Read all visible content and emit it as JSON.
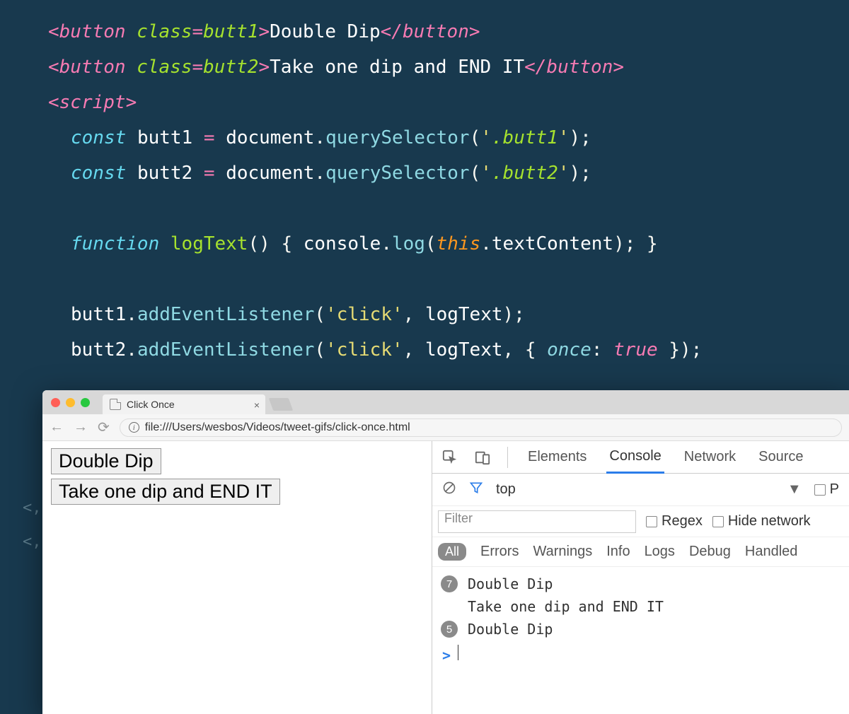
{
  "code": {
    "line1": {
      "tag_open": "<button",
      "attr": " class",
      "eq": "=",
      "val": "butt1",
      "gt": ">",
      "text": "Double Dip",
      "close": "</button>"
    },
    "line2": {
      "tag_open": "<button",
      "attr": " class",
      "eq": "=",
      "val": "butt2",
      "gt": ">",
      "text": "Take one dip and END IT",
      "close": "</button>"
    },
    "line3": {
      "open": "<script",
      "gt": ">"
    },
    "line4": {
      "kw": "const",
      "sp": " ",
      "id": "butt1",
      "eq": " = ",
      "doc": "document",
      "dot": ".",
      "fn": "querySelector",
      "lp": "(",
      "s1": "'",
      "sel": ".butt1",
      "s2": "'",
      "rp": ");"
    },
    "line5": {
      "kw": "const",
      "sp": " ",
      "id": "butt2",
      "eq": " = ",
      "doc": "document",
      "dot": ".",
      "fn": "querySelector",
      "lp": "(",
      "s1": "'",
      "sel": ".butt2",
      "s2": "'",
      "rp": ");"
    },
    "line6": {
      "kw": "function",
      "name": " logText",
      "args": "() ",
      "lb": "{ ",
      "obj": "console",
      "dot": ".",
      "fn": "log",
      "lp": "(",
      "this": "this",
      "dot2": ".",
      "prop": "textContent",
      "rp": "); ",
      "rb": "}"
    },
    "line7": {
      "id": "butt1",
      "dot": ".",
      "fn": "addEventListener",
      "lp": "(",
      "s1": "'click'",
      "c": ", ",
      "arg2": "logText",
      "rp": ");"
    },
    "line8": {
      "id": "butt2",
      "dot": ".",
      "fn": "addEventListener",
      "lp": "(",
      "s1": "'click'",
      "c": ", ",
      "arg2": "logText",
      "c2": ", ",
      "lb": "{ ",
      "key": "once",
      "colon": ": ",
      "val": "true",
      "rb": " }",
      "rp": ");"
    }
  },
  "gutter": {
    "g1": "<,",
    "g2": "<,"
  },
  "browser": {
    "tab_title": "Click Once",
    "url": "file:///Users/wesbos/Videos/tweet-gifs/click-once.html",
    "page": {
      "btn1": "Double Dip",
      "btn2": "Take one dip and END IT"
    }
  },
  "devtools": {
    "tabs": {
      "elements": "Elements",
      "console": "Console",
      "network": "Network",
      "sources": "Source"
    },
    "toolbar": {
      "context": "top",
      "preserve_short": "P"
    },
    "filter": {
      "placeholder": "Filter",
      "regex": "Regex",
      "hide_network": "Hide network"
    },
    "levels": {
      "all": "All",
      "errors": "Errors",
      "warnings": "Warnings",
      "info": "Info",
      "logs": "Logs",
      "debug": "Debug",
      "handled": "Handled"
    },
    "console": {
      "entries": [
        {
          "count": "7",
          "text": "Double Dip"
        },
        {
          "count": "",
          "text": "Take one dip and END IT"
        },
        {
          "count": "5",
          "text": "Double Dip"
        }
      ],
      "prompt": ">"
    }
  }
}
